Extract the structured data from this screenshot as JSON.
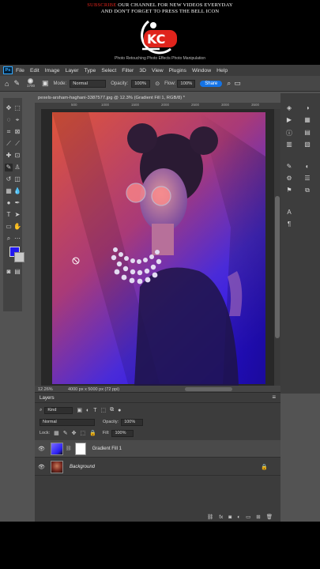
{
  "banner": {
    "line1_red": "SUBSCRIBE",
    "line1_white": " OUR CHANNEL FOR NEW VIDEOS EVERYDAY",
    "line2": "AND DON'T FORGET TO PRESS THE BELL ICON",
    "tagline": "Photo Retouching  Photo Effects  Photo Manipulation",
    "colors": {
      "accent": "#e0241c"
    }
  },
  "app": {
    "logo": "Ps",
    "menu": [
      "File",
      "Edit",
      "Image",
      "Layer",
      "Type",
      "Select",
      "Filter",
      "3D",
      "View",
      "Plugins",
      "Window",
      "Help"
    ]
  },
  "options": {
    "brush_size": "1700",
    "mode_label": "Mode:",
    "mode_value": "Normal",
    "opacity_label": "Opacity:",
    "opacity_value": "100%",
    "flow_label": "Flow:",
    "flow_value": "100%",
    "share_label": "Share"
  },
  "document": {
    "tab_title": "pexels-arsham-haghani-3387577.jpg @ 12.3% (Gradient Fill 1, RGB/8) *",
    "ruler_ticks": [
      "500",
      "1000",
      "1500",
      "2000",
      "2500",
      "3000",
      "3500"
    ],
    "zoom": "12.26%",
    "info": "4000 px x 5000 px (72 ppi)"
  },
  "colors": {
    "foreground": "#2218f0",
    "background": "#c9c9c9"
  },
  "layers": {
    "title": "Layers",
    "filter_value": "Kind",
    "blend_mode": "Normal",
    "opacity_label": "Opacity:",
    "opacity_value": "100%",
    "lock_label": "Lock:",
    "fill_label": "Fill:",
    "fill_value": "100%",
    "items": [
      {
        "name": "Gradient Fill 1",
        "selected": true
      },
      {
        "name": "Background",
        "selected": false,
        "locked": true
      }
    ]
  }
}
